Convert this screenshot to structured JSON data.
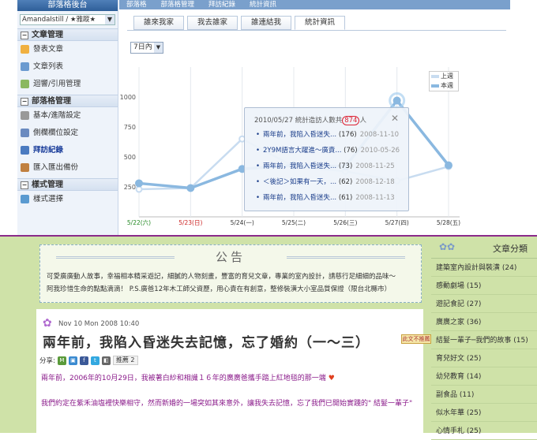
{
  "sidebar": {
    "header": "部落格後台",
    "user_select": "AmandaIstill / ★雅蹤★",
    "sections": [
      {
        "title": "文章管理",
        "items": [
          "發表文章",
          "文章列表",
          "迴響/引用管理"
        ]
      },
      {
        "title": "部落格管理",
        "items": [
          "基本/進階設定",
          "側欄欄位設定",
          "拜訪紀錄",
          "匯入匯出備份"
        ]
      },
      {
        "title": "樣式管理",
        "items": [
          "樣式選擇"
        ]
      }
    ],
    "active_item": "拜訪紀錄"
  },
  "breadcrumb": [
    "部落格",
    "部落格管理",
    "拜訪紀錄",
    "統計資訊"
  ],
  "tabs": [
    "誰來我家",
    "我去誰家",
    "誰連結我",
    "統計資訊"
  ],
  "active_tab": "統計資訊",
  "period_select": "7日內",
  "legend": [
    {
      "name": "上週",
      "color": "#c8dcf0"
    },
    {
      "name": "本週",
      "color": "#8ab8e0"
    }
  ],
  "chart_data": {
    "type": "line",
    "categories": [
      "5/22(六)",
      "5/23(日)",
      "5/24(一)",
      "5/25(二)",
      "5/26(三)",
      "5/27(四)",
      "5/28(五)"
    ],
    "category_colors": [
      "#228822",
      "#cc2222",
      "#333333",
      "#333333",
      "#333333",
      "#333333",
      "#333333"
    ],
    "yticks": [
      250,
      500,
      750,
      1000
    ],
    "ylim": [
      0,
      1250
    ],
    "series": [
      {
        "name": "上週",
        "values": [
          230,
          240,
          650,
          420,
          380,
          300,
          420
        ]
      },
      {
        "name": "本週",
        "values": [
          280,
          240,
          400,
          430,
          420,
          970,
          430
        ]
      }
    ],
    "tooltip": {
      "prefix": "2010/05/27 統計造訪人數共",
      "count": "874",
      "suffix": "人",
      "rows": [
        {
          "title": "兩年前，我陷入昏迷失...",
          "count": "(176)",
          "date": "2008-11-10"
        },
        {
          "title": "2Y9M語言大躍進～廣責...",
          "count": "(76)",
          "date": "2010-05-26"
        },
        {
          "title": "兩年前，我陷入昏迷失...",
          "count": "(73)",
          "date": "2008-11-25"
        },
        {
          "title": "＜後記＞如果有一天，...",
          "count": "(62)",
          "date": "2008-12-18"
        },
        {
          "title": "兩年前，我陷入昏迷失...",
          "count": "(61)",
          "date": "2008-11-13"
        }
      ]
    }
  },
  "notice": {
    "title": "公告",
    "line1": "可愛廣廣動人故事，幸福相本精采遊記，細膩的人物刻畫，豐富的育兒文章，專業的室內設計，請慈行足細細的品味～",
    "line2": "阿我珍惜生命的點點滴滴！ P.S.廣爸12年木工師父資歷，用心責在有創意，整修裝潢大小室品質保證（限台北縣市）"
  },
  "post": {
    "date": "Nov 10 Mon 2008 10:40",
    "title": "兩年前，我陷入昏迷失去記憶，忘了婚約（一～三）",
    "badge": "此文不推薦",
    "share_label": "分享:",
    "push_label": "推薦",
    "push_count": "2",
    "para1": "兩年前，2006年的10月29日，我被著白紗和相識１６年的廣廣爸攜手踏上紅地毯的那一端",
    "para2": "我們約定在紫禾油塩裡快樂相守，然而新婚的一場突如其來意外，讓我失去記憶，忘了我們已開始實踐的\" 結髮一輩子\""
  },
  "categories": {
    "header": "文章分類",
    "items": [
      "建築室內設計與裝潢 (24)",
      "感動劇場 (15)",
      "遊記食記 (27)",
      "廣廣之家 (36)",
      "結髮一輩子─我們的故事 (15)",
      "育兒好文 (25)",
      "幼兒教育 (14)",
      "副食品 (11)",
      "似水年華 (25)",
      "心情手札 (25)"
    ]
  }
}
